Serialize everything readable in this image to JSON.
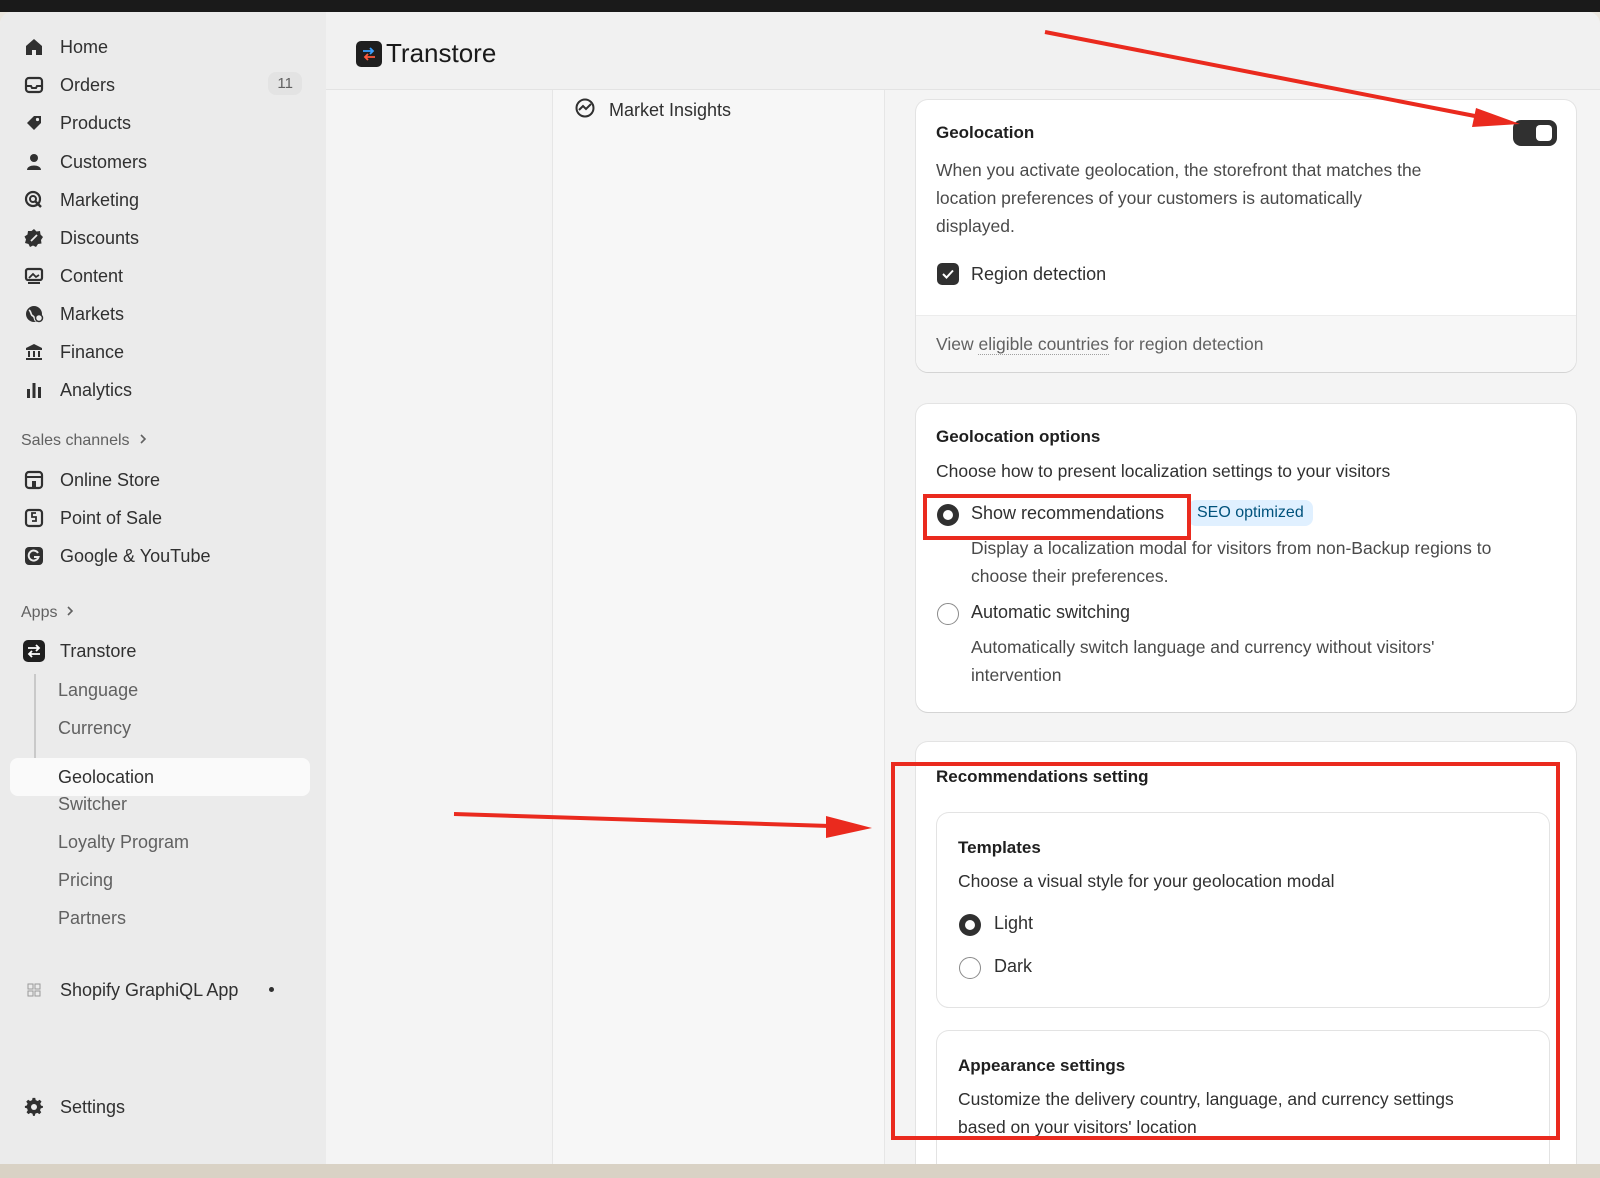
{
  "sidebar": {
    "main_items": [
      {
        "label": "Home",
        "icon": "home-icon"
      },
      {
        "label": "Orders",
        "icon": "orders-icon",
        "badge": "11"
      },
      {
        "label": "Products",
        "icon": "tag-icon"
      },
      {
        "label": "Customers",
        "icon": "person-icon"
      },
      {
        "label": "Marketing",
        "icon": "target-icon"
      },
      {
        "label": "Discounts",
        "icon": "discount-icon"
      },
      {
        "label": "Content",
        "icon": "image-icon"
      },
      {
        "label": "Markets",
        "icon": "globe-icon"
      },
      {
        "label": "Finance",
        "icon": "bank-icon"
      },
      {
        "label": "Analytics",
        "icon": "bar-chart-icon"
      }
    ],
    "sales_channels_label": "Sales channels",
    "sales_channels": [
      {
        "label": "Online Store",
        "icon": "store-icon"
      },
      {
        "label": "Point of Sale",
        "icon": "pos-icon"
      },
      {
        "label": "Google & YouTube",
        "icon": "google-icon"
      }
    ],
    "apps_label": "Apps",
    "app_name": "Transtore",
    "app_subitems": [
      "Language",
      "Currency",
      "Geolocation",
      "Switcher",
      "Loyalty Program",
      "Pricing",
      "Partners"
    ],
    "active_subitem": "Geolocation",
    "other_app": "Shopify GraphiQL App",
    "settings_label": "Settings"
  },
  "header": {
    "title": "Transtore"
  },
  "subnav": {
    "market_insights": "Market Insights"
  },
  "geolocation_card": {
    "title": "Geolocation",
    "enabled": true,
    "description_lines": [
      "When you activate geolocation, the storefront that matches the",
      "location preferences of your customers is automatically",
      "displayed."
    ],
    "checkbox_label": "Region detection",
    "checkbox_checked": true,
    "footer_link_pre": "View ",
    "footer_link_underlined": "eligible countries",
    "footer_link_post": " for region detection"
  },
  "options_card": {
    "title": "Geolocation options",
    "subtitle": "Choose how to present localization settings to your visitors",
    "option1_label": "Show recommendations",
    "option1_badge": "SEO optimized",
    "option1_desc_lines": [
      "Display a localization modal for visitors from non-Backup regions to",
      "choose their preferences."
    ],
    "option2_label": "Automatic switching",
    "option2_desc_lines": [
      "Automatically switch language and currency without visitors'",
      "intervention"
    ],
    "selected": "Show recommendations"
  },
  "recommendations_card": {
    "title": "Recommendations setting",
    "templates_title": "Templates",
    "templates_subtitle": "Choose a visual style for your geolocation modal",
    "template_options": [
      "Light",
      "Dark"
    ],
    "template_selected": "Light",
    "appearance_title": "Appearance settings",
    "appearance_desc_lines": [
      "Customize the delivery country, language, and currency settings",
      "based on your visitors' location"
    ]
  },
  "colors": {
    "annotation_red": "#ea2a1e",
    "seo_badge_bg": "#e0f0ff",
    "toggle_on": "#303030"
  }
}
